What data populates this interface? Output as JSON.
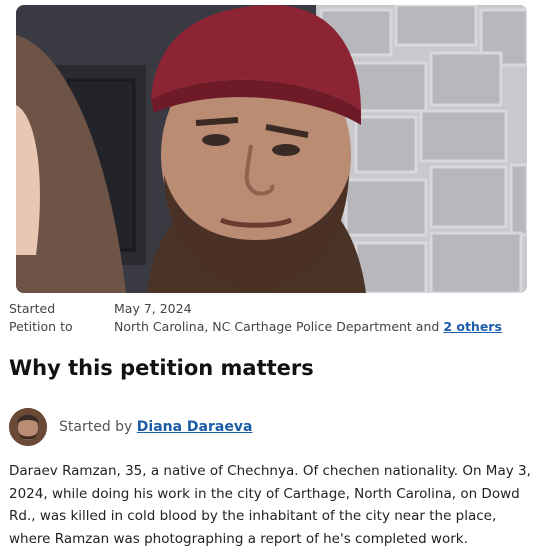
{
  "photo": {
    "icon": "person-photo"
  },
  "meta": {
    "started_label": "Started",
    "started_value": "May 7, 2024",
    "petition_to_label": "Petition to",
    "petition_to_value": "North Carolina, NC Carthage Police Department and",
    "others_link": "2 others"
  },
  "section": {
    "heading": "Why this petition matters"
  },
  "starter": {
    "prefix": "Started by",
    "name": "Diana Daraeva",
    "avatar_icon": "user-avatar"
  },
  "description": "Daraev Ramzan, 35, a native of Chechnya. Of chechen nationality. On May 3, 2024, while doing his work in the city of Carthage, North Carolina, on Dowd Rd., was killed in cold blood by the inhabitant of the city near the place, where Ramzan was photographing a report of he's completed work."
}
